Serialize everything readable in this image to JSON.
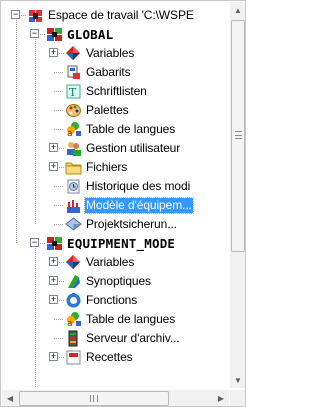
{
  "tree": [
    {
      "label": "Espace de travail 'C:\\WSPE",
      "icon": "workspace-icon",
      "expander": "minus",
      "bold": false,
      "selected": false
    },
    {
      "label": "GLOBAL",
      "icon": "project-icon",
      "expander": "minus",
      "bold": true,
      "selected": false
    },
    {
      "label": "Variables",
      "icon": "variables-icon",
      "expander": "plus",
      "bold": false,
      "selected": false
    },
    {
      "label": "Gabarits",
      "icon": "templates-icon",
      "expander": "none",
      "bold": false,
      "selected": false
    },
    {
      "label": "Schriftlisten",
      "icon": "font-list-icon",
      "expander": "none",
      "bold": false,
      "selected": false
    },
    {
      "label": "Palettes",
      "icon": "palette-icon",
      "expander": "none",
      "bold": false,
      "selected": false
    },
    {
      "label": "Table de langues",
      "icon": "language-table-icon",
      "expander": "none",
      "bold": false,
      "selected": false
    },
    {
      "label": "Gestion utilisateur",
      "icon": "user-management-icon",
      "expander": "plus",
      "bold": false,
      "selected": false
    },
    {
      "label": "Fichiers",
      "icon": "folder-icon",
      "expander": "plus",
      "bold": false,
      "selected": false
    },
    {
      "label": "Historique des modi",
      "icon": "change-history-icon",
      "expander": "none",
      "bold": false,
      "selected": false
    },
    {
      "label": "Modèle d'équipem...",
      "icon": "equipment-model-icon",
      "expander": "none",
      "bold": false,
      "selected": true
    },
    {
      "label": "Projektsicherun...",
      "icon": "project-backup-icon",
      "expander": "none",
      "bold": false,
      "selected": false
    },
    {
      "label": "EQUIPMENT_MODE",
      "icon": "project-icon",
      "expander": "minus",
      "bold": true,
      "selected": false
    },
    {
      "label": "Variables",
      "icon": "variables-icon",
      "expander": "plus",
      "bold": false,
      "selected": false
    },
    {
      "label": "Synoptiques",
      "icon": "screens-icon",
      "expander": "plus",
      "bold": false,
      "selected": false
    },
    {
      "label": "Fonctions",
      "icon": "functions-icon",
      "expander": "plus",
      "bold": false,
      "selected": false
    },
    {
      "label": "Table de langues",
      "icon": "language-table-icon",
      "expander": "none",
      "bold": false,
      "selected": false
    },
    {
      "label": "Serveur d'archiv...",
      "icon": "archive-server-icon",
      "expander": "none",
      "bold": false,
      "selected": false
    },
    {
      "label": "Recettes",
      "icon": "recipes-icon",
      "expander": "plus",
      "bold": false,
      "selected": false
    }
  ],
  "scrollbars": {
    "vertical": {
      "up_icon": "▲",
      "down_icon": "▼"
    },
    "horizontal": {
      "left_icon": "◀",
      "right_icon": "▶",
      "grip": "III"
    }
  },
  "colors": {
    "selection": "#3399ff",
    "tree_line": "#a0a0a0"
  }
}
